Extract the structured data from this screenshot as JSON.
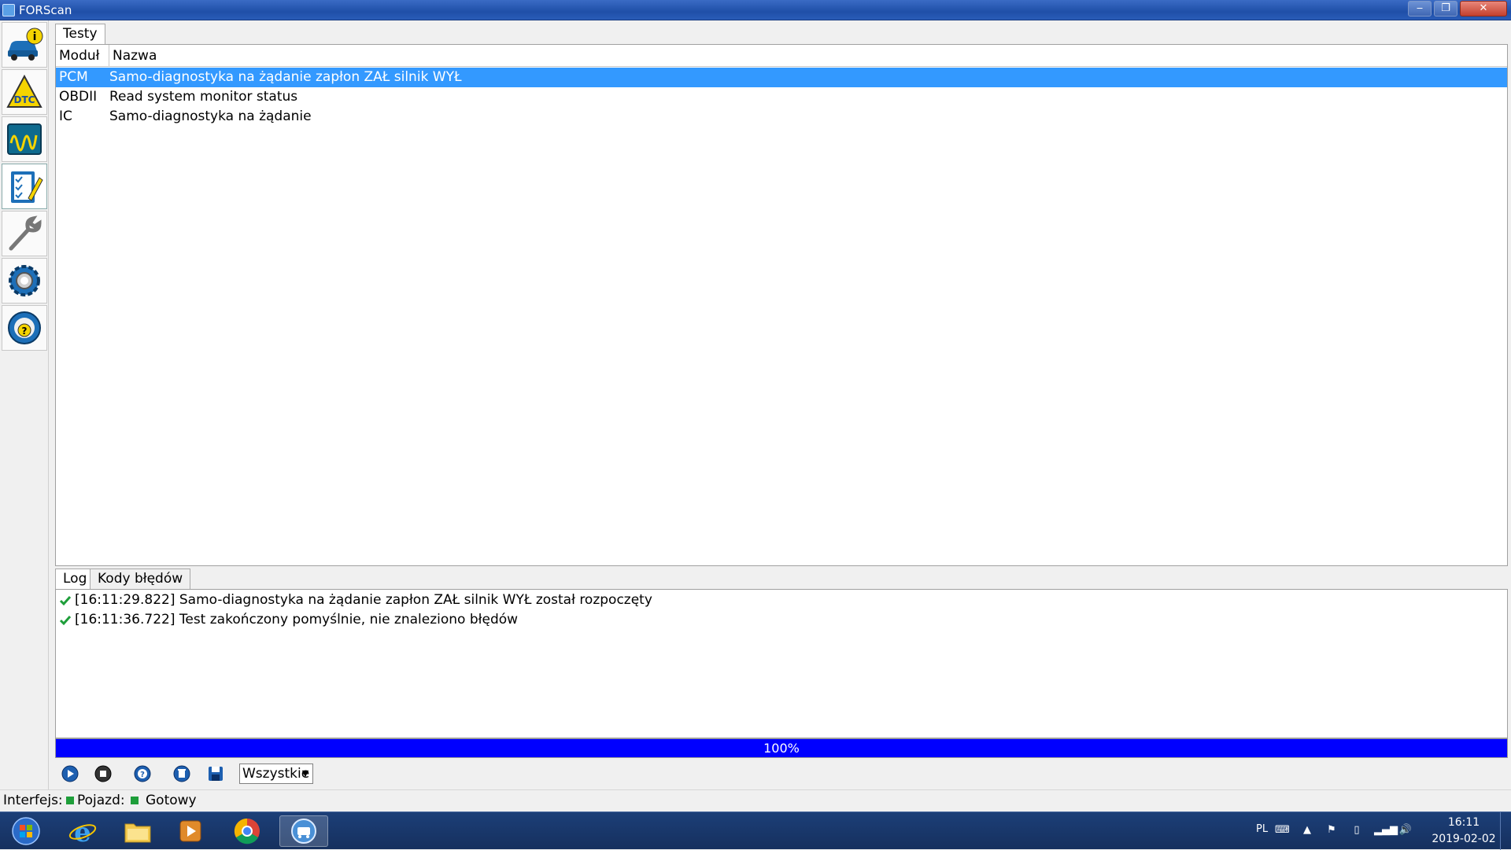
{
  "window": {
    "title": "FORScan"
  },
  "sidebar": {
    "items": [
      {
        "name": "vehicle-info"
      },
      {
        "name": "dtc"
      },
      {
        "name": "live-data"
      },
      {
        "name": "tests",
        "active": true
      },
      {
        "name": "service"
      },
      {
        "name": "settings"
      },
      {
        "name": "help"
      }
    ]
  },
  "tests": {
    "tab_label": "Testy",
    "columns": [
      "Moduł",
      "Nazwa"
    ],
    "rows": [
      {
        "module": "PCM",
        "name": "Samo-diagnostyka na żądanie zapłon ZAŁ silnik WYŁ",
        "selected": true
      },
      {
        "module": "OBDII",
        "name": "Read system monitor status",
        "selected": false
      },
      {
        "module": "IC",
        "name": "Samo-diagnostyka na żądanie",
        "selected": false
      }
    ]
  },
  "log": {
    "tabs": [
      "Log",
      "Kody błędów"
    ],
    "lines": [
      {
        "text": "[16:11:29.822] Samo-diagnostyka na żądanie zapłon ZAŁ silnik WYŁ został rozpoczęty"
      },
      {
        "text": "[16:11:36.722] Test zakończony pomyślnie, nie znaleziono błędów"
      }
    ]
  },
  "progress": {
    "value": 1.0,
    "label": "100%"
  },
  "toolbar": {
    "filter": "Wszystkie"
  },
  "status": {
    "interface_label": "Interfejs:",
    "vehicle_label": "Pojazd:",
    "ready_label": "Gotowy",
    "ok_color": "#1e9e3a"
  },
  "taskbar": {
    "apps": [
      "start",
      "internet-explorer",
      "file-explorer",
      "media-player",
      "chrome",
      "forscan"
    ],
    "lang": "PL",
    "time": "16:11",
    "date": "2019-02-02"
  },
  "colors": {
    "selection": "#3399ff",
    "progress": "#0000ff",
    "titlebar": "#1f4fa8"
  }
}
